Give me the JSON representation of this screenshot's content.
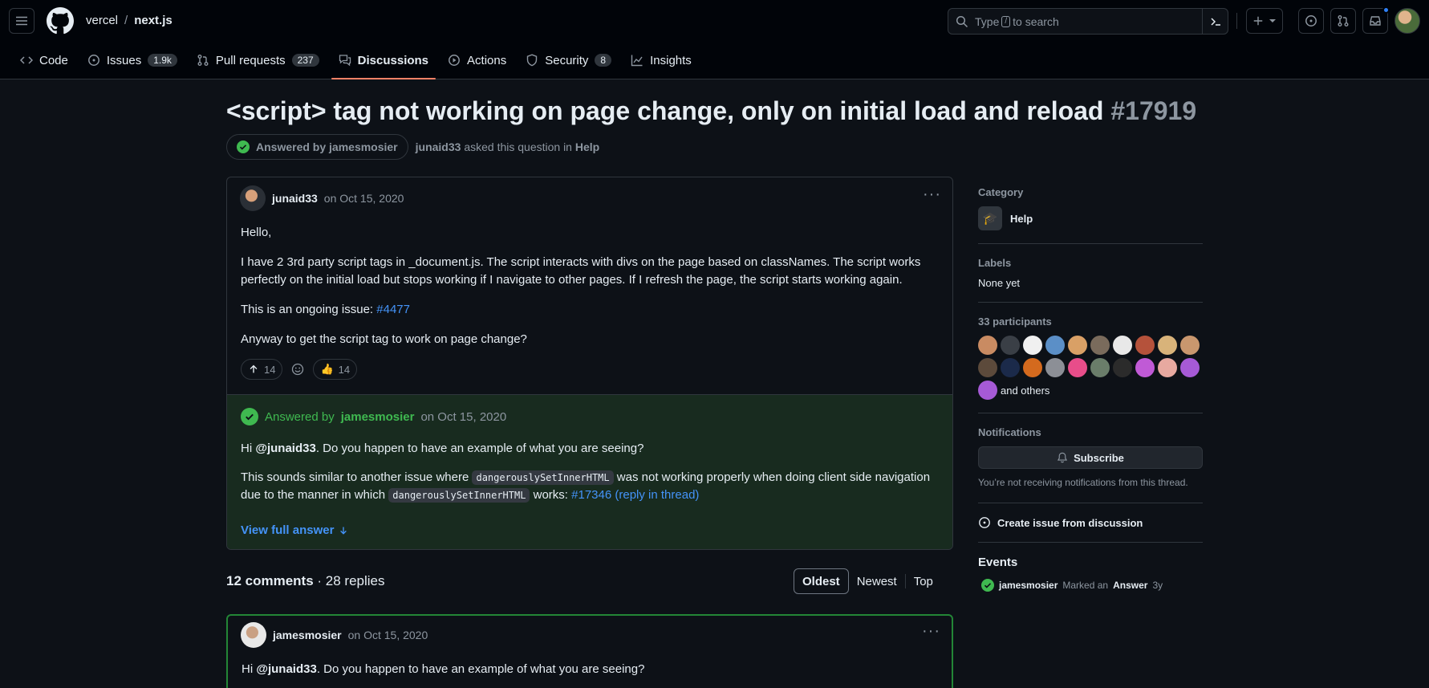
{
  "header": {
    "owner": "vercel",
    "separator": "/",
    "repo": "next.js",
    "search_prefix": "Type",
    "search_key": "/",
    "search_suffix": "to search"
  },
  "nav": {
    "tabs": [
      {
        "label": "Code",
        "icon": "code-icon"
      },
      {
        "label": "Issues",
        "icon": "issue-opened-icon",
        "count": "1.9k"
      },
      {
        "label": "Pull requests",
        "icon": "git-pull-request-icon",
        "count": "237"
      },
      {
        "label": "Discussions",
        "icon": "comment-discussion-icon",
        "active": true
      },
      {
        "label": "Actions",
        "icon": "play-icon"
      },
      {
        "label": "Security",
        "icon": "shield-icon",
        "count": "8"
      },
      {
        "label": "Insights",
        "icon": "graph-icon"
      }
    ]
  },
  "discussion": {
    "title": "<script> tag not working on page change, only on initial load and reload",
    "number": "#17919",
    "answered_label": "Answered by jamesmosier",
    "asker": "junaid33",
    "asked_text": "asked this question in",
    "category": "Help"
  },
  "post": {
    "author": "junaid33",
    "date": "on Oct 15, 2020",
    "p1": "Hello,",
    "p2": "I have 2 3rd party script tags in _document.js. The script interacts with divs on the page based on classNames. The script works perfectly on the initial load but stops working if I navigate to other pages. If I refresh the page, the script starts working again.",
    "p3_prefix": "This is an ongoing issue: ",
    "p3_link": "#4477",
    "p4": "Anyway to get the script tag to work on page change?",
    "upvotes": "14",
    "thumbs": "14",
    "thumbs_emoji": "👍"
  },
  "answer": {
    "label": "Answered by",
    "author": "jamesmosier",
    "date": "on Oct 15, 2020",
    "greet_prefix": "Hi ",
    "greet_mention": "@junaid33",
    "greet_suffix": ". Do you happen to have an example of what you are seeing?",
    "line2_a": "This sounds similar to another issue where ",
    "code": "dangerouslySetInnerHTML",
    "line2_b": " was not working properly when doing client side navigation due to the manner in which ",
    "line2_c": " works: ",
    "link": "#17346 (reply in thread)",
    "view_full": "View full answer"
  },
  "comments": {
    "count": "12 comments",
    "dot": " · ",
    "replies": "28 replies",
    "sort_options": [
      "Oldest",
      "Newest",
      "Top"
    ],
    "first_author": "jamesmosier",
    "first_date": "on Oct 15, 2020",
    "first_prefix": "Hi ",
    "first_mention": "@junaid33",
    "first_suffix": ". Do you happen to have an example of what you are seeing?"
  },
  "sidebar": {
    "category_label": "Category",
    "category": "Help",
    "category_emoji": "🎓",
    "labels_label": "Labels",
    "labels_value": "None yet",
    "participants_label": "33 participants",
    "and_others": "and others",
    "participant_colors": [
      "#c98b62",
      "#3a3f46",
      "#f0f0f0",
      "#5b8fc7",
      "#d9a066",
      "#7a6b5c",
      "#e8e8e8",
      "#b5523b",
      "#d8b37a",
      "#c9976e",
      "#5c4a3b",
      "#1b2a4a",
      "#d46a1e",
      "#8c8f96",
      "#e84d8a",
      "#6a7d6a",
      "#2b2b2b",
      "#c05ad6",
      "#e7a9a0",
      "#a65ad6"
    ],
    "notifications_label": "Notifications",
    "subscribe": "Subscribe",
    "notif_note": "You’re not receiving notifications from this thread.",
    "create_issue": "Create issue from discussion",
    "events_label": "Events",
    "event_user": "jamesmosier",
    "event_marked": "Marked an",
    "event_answer": "Answer",
    "event_time": "3y"
  },
  "colors": {
    "accent_link": "#4493f8",
    "success": "#3fb950",
    "active_tab_underline": "#f78166"
  }
}
